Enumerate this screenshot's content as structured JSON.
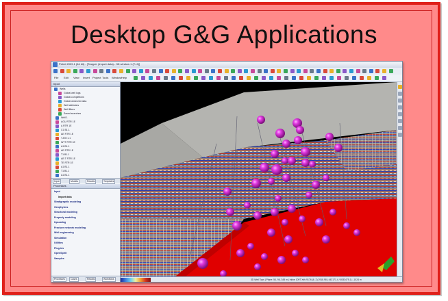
{
  "slide": {
    "title": "Desktop G&G Applications",
    "colors": {
      "frame_fill": "#ff8a8a",
      "frame_border": "#e0201a"
    }
  },
  "app_window": {
    "title": "Petrel 2009.1 (64 bit) - [Trapper (Import data) - 3D window 1 (T=0)]",
    "menu": [
      "File",
      "Edit",
      "View",
      "Insert",
      "Project",
      "Tools",
      "Window",
      "Help"
    ],
    "input_panel": {
      "header": "Input",
      "items": [
        "Wells",
        "Global well logs",
        "Global completions",
        "Global observed data",
        "Well attributes",
        "Well filters",
        "Saved searches",
        "Well 1",
        "AGU RTR 1E",
        "A RTR 1E",
        "C1 B1.1",
        "AE RTR 1E",
        "T-EM 1.1",
        "WTT RTR 1E",
        "A1 B1.1",
        "AE RTR 1E",
        "T1 B1.1",
        "AB T RTR 1E",
        "TE RTR 1E",
        "A1 B1.1",
        "T1 B1.1",
        "A1 B1.1"
      ],
      "tabs": [
        "Input",
        "Models",
        "Results",
        "Templates"
      ]
    },
    "processes_panel": {
      "header": "Processes",
      "items": [
        "Input",
        "Import data",
        "Stratigraphic modeling",
        "Geophysics",
        "Structural modeling",
        "Property modeling",
        "Upscaling",
        "Fracture network modeling",
        "Well engineering",
        "Simulation",
        "Utilities",
        "Plug-ins",
        "OpenSpirit",
        "Samples"
      ],
      "tabs": [
        "Processes",
        "Cases",
        "Results",
        "Workflows"
      ]
    },
    "status_text": "3D Well Tops   |   Plane: 54, 96, 345 m   |   Inline 1097   Xtrk 9176 (6. 2)   2918.98   |   443171.4 / 6533475.1   |   -1024 m"
  },
  "viewport_3d": {
    "background": "#000000",
    "wall_color": "#b4b4b0",
    "horizon_color": "#e00000",
    "sphere_color": "#d22ad2",
    "spheres": [
      {
        "depth_group": "upper",
        "count": 22
      },
      {
        "depth_group": "lower",
        "count": 26
      }
    ]
  }
}
